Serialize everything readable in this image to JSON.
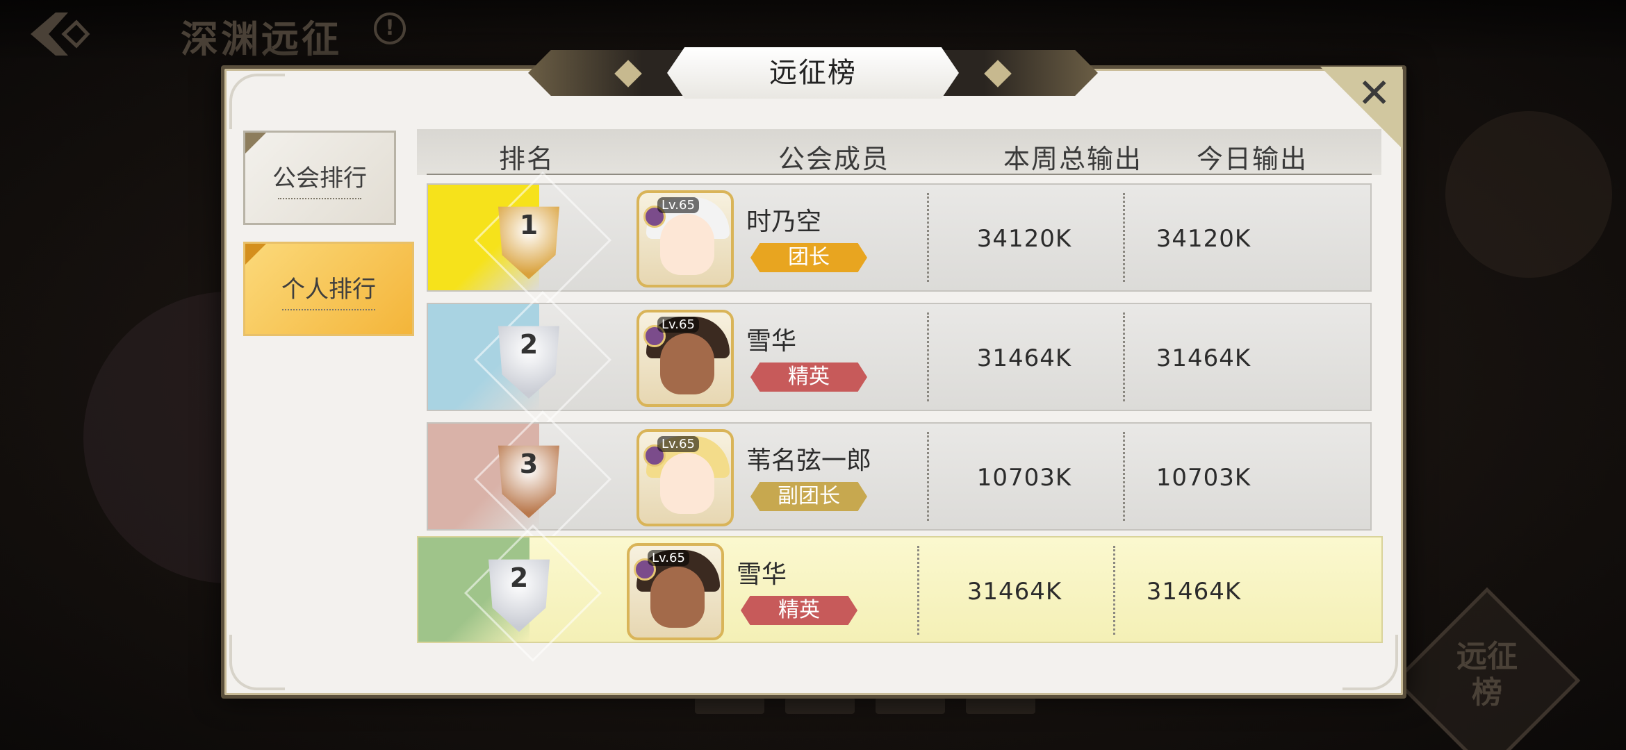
{
  "screen": {
    "title": "深渊远征",
    "info_icon": "!",
    "corner_button_label": "远征榜"
  },
  "modal": {
    "title": "远征榜",
    "close_icon": "✕"
  },
  "tabs": [
    {
      "label": "公会排行",
      "active": false
    },
    {
      "label": "个人排行",
      "active": true
    }
  ],
  "table": {
    "headers": [
      "排名",
      "公会成员",
      "本周总输出",
      "今日输出"
    ],
    "rows": [
      {
        "rank": "1",
        "level": "Lv.65",
        "name": "时乃空",
        "role": "团长",
        "role_color": "#e8a520",
        "weekly": "34120K",
        "today": "34120K",
        "rank_color": "#f6e21b",
        "badge_color": "#d9a13b",
        "hair_color": "#f3f3f3",
        "face_color": "#fde7d6"
      },
      {
        "rank": "2",
        "level": "Lv.65",
        "name": "雪华",
        "role": "精英",
        "role_color": "#c75a5a",
        "weekly": "31464K",
        "today": "31464K",
        "rank_color": "#a9d3e2",
        "badge_color": "#c9ccd4",
        "hair_color": "#3b2a20",
        "face_color": "#a36a4a"
      },
      {
        "rank": "3",
        "level": "Lv.65",
        "name": "苇名弦一郎",
        "role": "副团长",
        "role_color": "#c7a84f",
        "weekly": "10703K",
        "today": "10703K",
        "rank_color": "#d9b2a8",
        "badge_color": "#b9784c",
        "hair_color": "#f3dc8a",
        "face_color": "#fde7d6"
      }
    ],
    "self_row": {
      "rank": "2",
      "level": "Lv.65",
      "name": "雪华",
      "role": "精英",
      "role_color": "#c75a5a",
      "weekly": "31464K",
      "today": "31464K",
      "rank_color": "#9fc48a",
      "badge_color": "#c9ccd4",
      "hair_color": "#3b2a20",
      "face_color": "#a36a4a"
    }
  }
}
